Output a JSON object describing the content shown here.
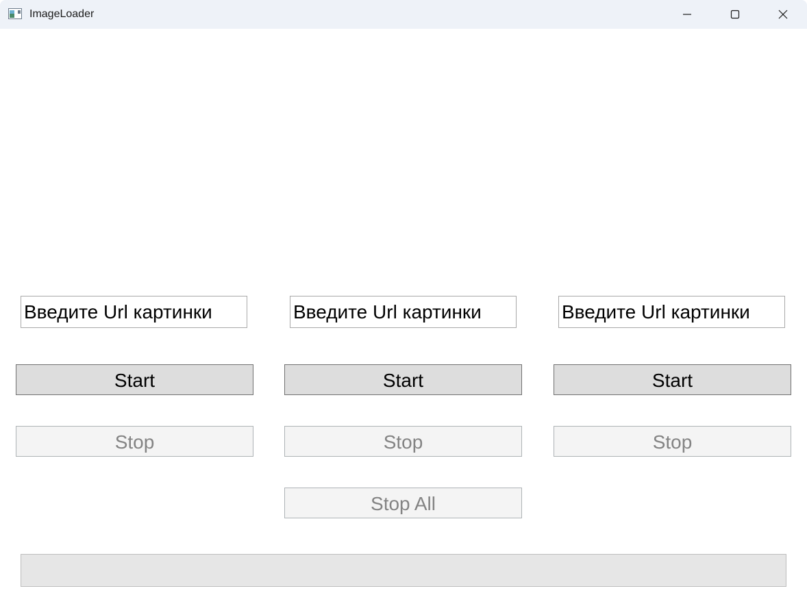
{
  "window": {
    "title": "ImageLoader",
    "icon": "app-window-icon",
    "controls": [
      "minimize-icon",
      "maximize-icon",
      "close-icon"
    ]
  },
  "loaders": [
    {
      "url_value": "Введите Url картинки",
      "start_label": "Start",
      "stop_label": "Stop"
    },
    {
      "url_value": "Введите Url картинки",
      "start_label": "Start",
      "stop_label": "Stop"
    },
    {
      "url_value": "Введите Url картинки",
      "start_label": "Start",
      "stop_label": "Stop"
    }
  ],
  "stop_all_label": "Stop All",
  "progress": {
    "fraction": 0
  },
  "colors": {
    "titlebar": "#eef2f8",
    "start_button_bg": "#dddddd",
    "disabled_button_bg": "#f4f4f4",
    "disabled_text": "#838383",
    "progress_track": "#e6e6e6",
    "progress_fill": "#06b025"
  }
}
